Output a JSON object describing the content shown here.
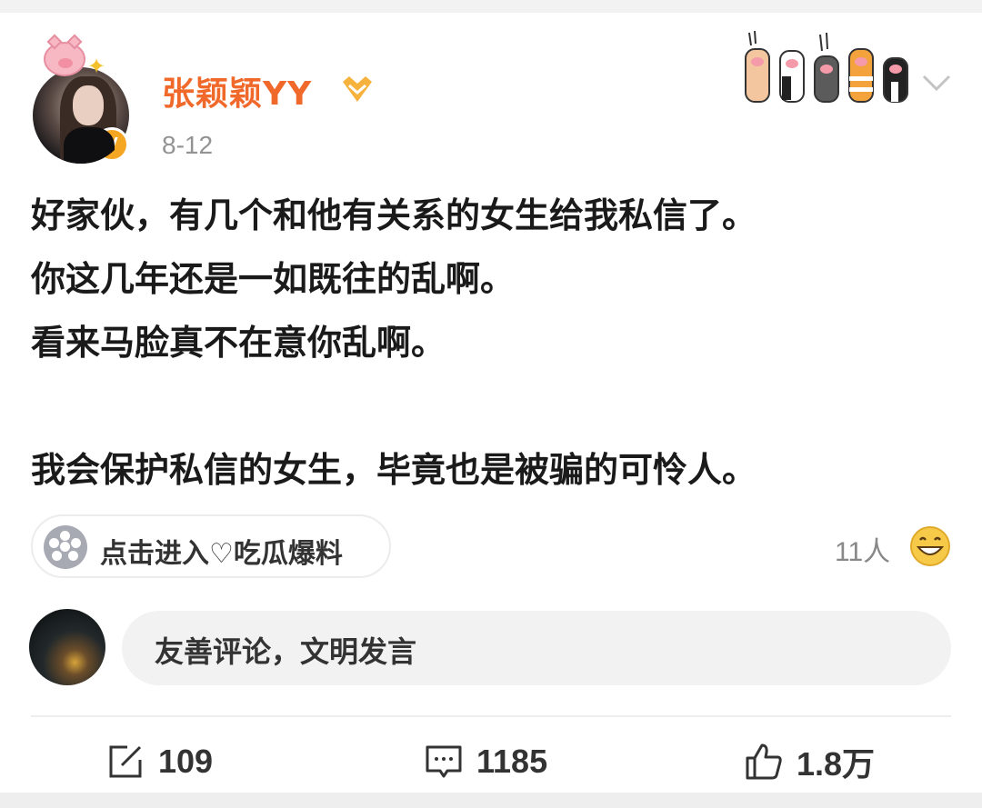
{
  "post": {
    "author": "张颖颖YY",
    "date": "8-12",
    "verified_badge": "V",
    "text_lines": [
      "好家伙，有几个和他有关系的女生给我私信了。",
      "你这几年还是一如既往的乱啊。",
      "看来马脸真不在意你乱啊。",
      "",
      "我会保护私信的女生，毕竟也是被骗的可怜人。"
    ]
  },
  "topic": {
    "label": "点击进入♡吃瓜爆料",
    "icon": "supertopic-icon"
  },
  "reactions": {
    "count": "11人",
    "icon": "grin-emoji-icon"
  },
  "comment_input": {
    "placeholder": "友善评论，文明发言"
  },
  "actions": {
    "repost": "109",
    "comment": "1185",
    "like": "1.8万"
  },
  "colors": {
    "username": "#f0692b",
    "badge": "#f5a623",
    "background": "#ffffff",
    "page": "#f2f2f2"
  }
}
